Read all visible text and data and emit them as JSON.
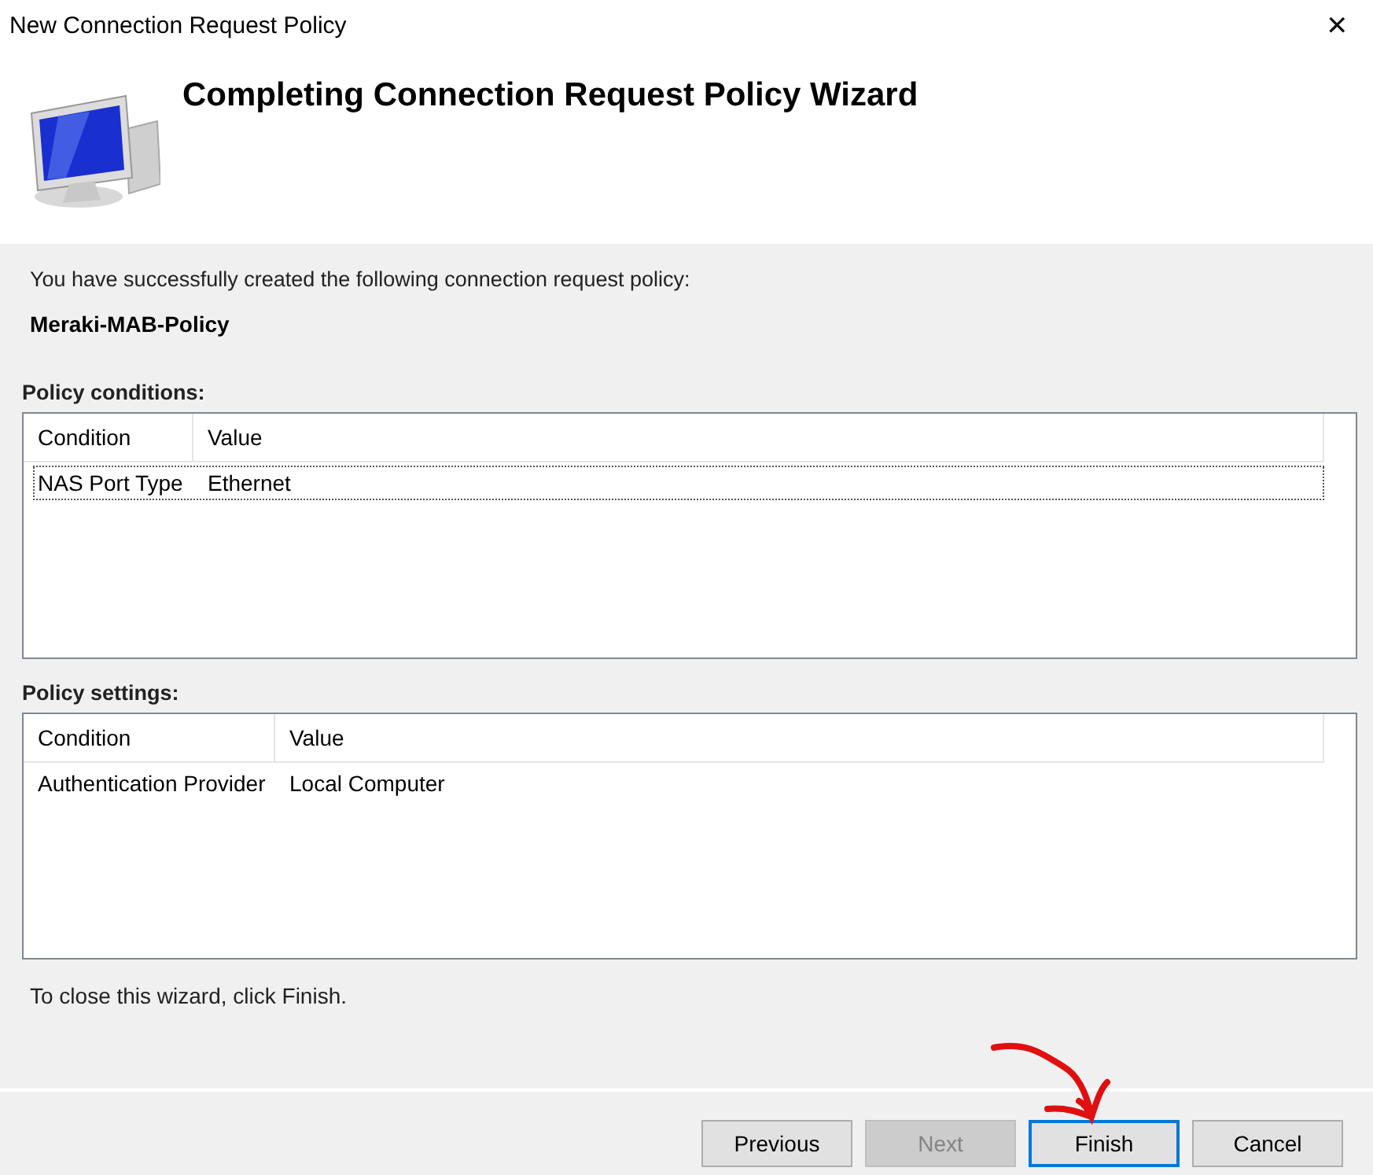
{
  "window": {
    "title": "New Connection Request Policy",
    "close": "✕"
  },
  "header": {
    "title": "Completing Connection Request Policy Wizard"
  },
  "intro": "You have successfully created the following connection request policy:",
  "policy_name": "Meraki-MAB-Policy",
  "tables": [
    {
      "label": "Policy conditions:",
      "columns": [
        "Condition",
        "Value"
      ],
      "rows": [
        {
          "cells": [
            "NAS Port Type",
            "Ethernet"
          ],
          "selected": true
        }
      ]
    },
    {
      "label": "Policy settings:",
      "columns": [
        "Condition",
        "Value"
      ],
      "rows": [
        {
          "cells": [
            "Authentication Provider",
            "Local Computer"
          ],
          "selected": false
        }
      ]
    }
  ],
  "closing_note": "To close this wizard, click Finish.",
  "buttons": [
    {
      "label": "Previous",
      "disabled": false,
      "default": false
    },
    {
      "label": "Next",
      "disabled": true,
      "default": false
    },
    {
      "label": "Finish",
      "disabled": false,
      "default": true
    },
    {
      "label": "Cancel",
      "disabled": false,
      "default": false
    }
  ],
  "annotation": {
    "kind": "arrow"
  }
}
